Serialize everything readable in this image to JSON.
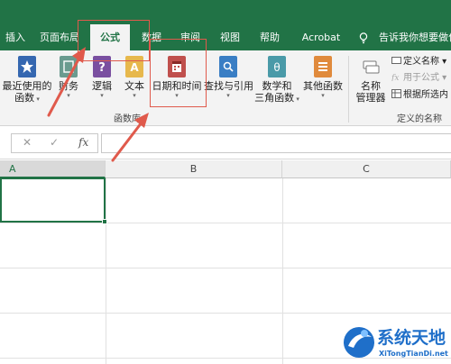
{
  "tabs": [
    {
      "label": "插入",
      "active": false
    },
    {
      "label": "页面布局",
      "active": false
    },
    {
      "label": "公式",
      "active": true
    },
    {
      "label": "数据",
      "active": false
    },
    {
      "label": "审阅",
      "active": false
    },
    {
      "label": "视图",
      "active": false
    },
    {
      "label": "帮助",
      "active": false
    },
    {
      "label": "Acrobat",
      "active": false
    }
  ],
  "tell_me": "告诉我你想要做什",
  "ribbon": {
    "function_library": {
      "group_label": "函数库",
      "buttons": [
        {
          "line1": "最近使用的",
          "line2": "函数",
          "icon": "star-icon"
        },
        {
          "line1": "财务",
          "line2": "",
          "icon": "finance-book-icon"
        },
        {
          "line1": "逻辑",
          "line2": "",
          "icon": "question-book-icon"
        },
        {
          "line1": "文本",
          "line2": "",
          "icon": "text-book-icon"
        },
        {
          "line1": "日期和时间",
          "line2": "",
          "icon": "calendar-book-icon"
        },
        {
          "line1": "查找与引用",
          "line2": "",
          "icon": "search-book-icon"
        },
        {
          "line1": "数学和",
          "line2": "三角函数",
          "icon": "theta-book-icon"
        },
        {
          "line1": "其他函数",
          "line2": "",
          "icon": "more-book-icon"
        }
      ]
    },
    "defined_names": {
      "group_label": "定义的名称",
      "name_manager_line1": "名称",
      "name_manager_line2": "管理器",
      "define_name": "定义名称",
      "use_in_formula": "用于公式",
      "create_from_selection": "根据所选内"
    }
  },
  "formula_bar": {
    "cancel_symbol": "✕",
    "enter_symbol": "✓",
    "fx_symbol": "fx",
    "value": ""
  },
  "grid": {
    "columns": [
      "A",
      "B",
      "C"
    ],
    "active_column": "A"
  },
  "watermark": {
    "title": "系统天地",
    "subtitle": "XiTongTianDi.net"
  },
  "colors": {
    "excel_green": "#217346",
    "annotation_red": "#e05a4c"
  }
}
